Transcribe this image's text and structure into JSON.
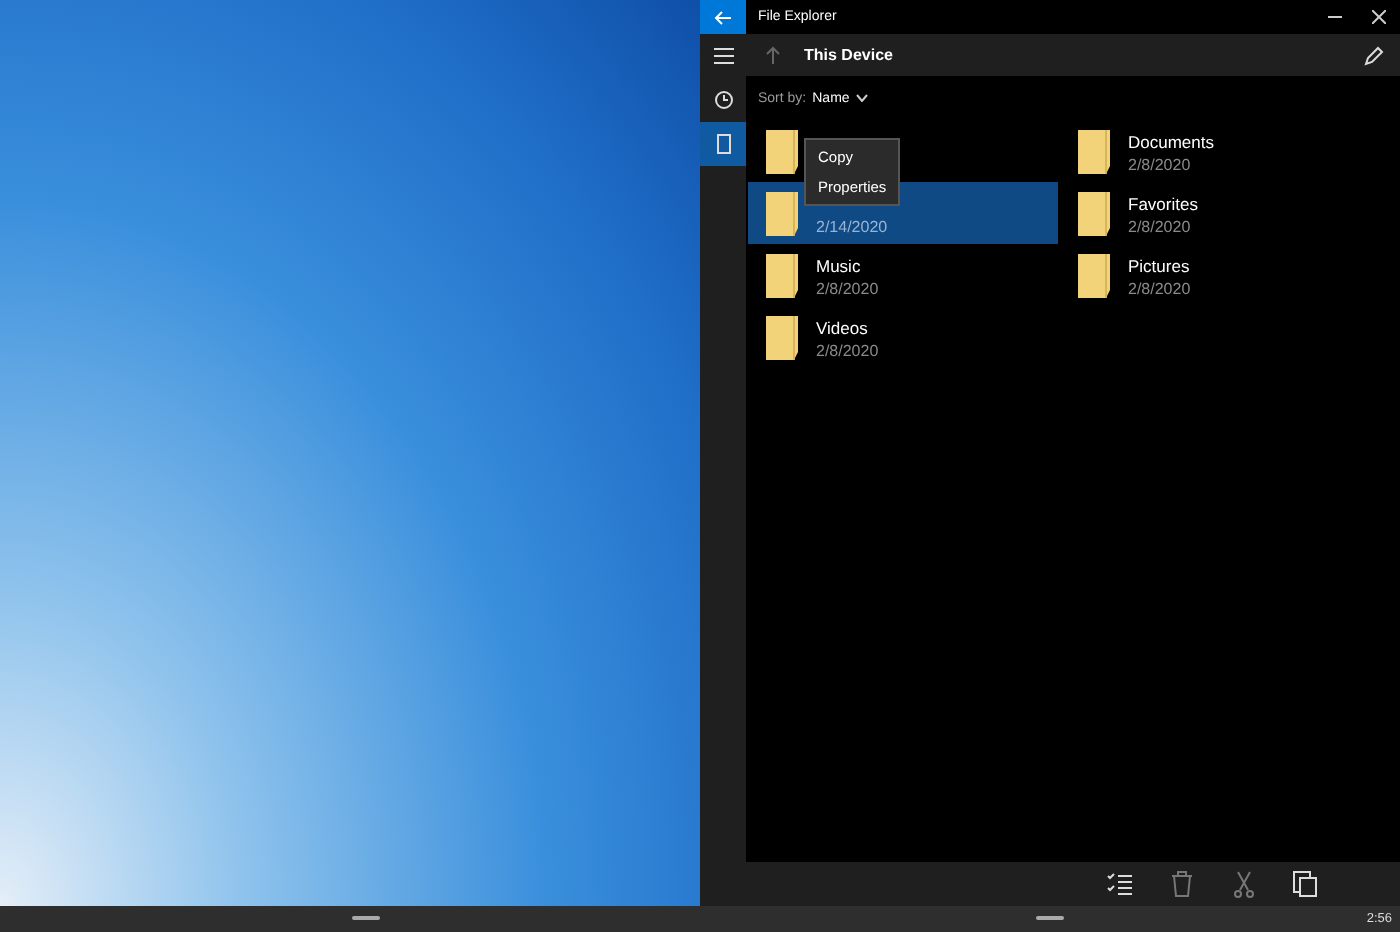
{
  "window": {
    "title": "File Explorer"
  },
  "header": {
    "title": "This Device"
  },
  "sort": {
    "label": "Sort by:",
    "value": "Name"
  },
  "nav_rail": [
    {
      "kind": "recent",
      "selected": false
    },
    {
      "kind": "device",
      "selected": true
    }
  ],
  "items": [
    {
      "selected": false
    },
    {
      "date": "2/14/2020",
      "selected": true
    },
    {
      "name": "Music",
      "date": "2/8/2020",
      "selected": false
    },
    {
      "name": "Videos",
      "date": "2/8/2020",
      "selected": false
    },
    {
      "name": "Documents",
      "date": "2/8/2020",
      "selected": false
    },
    {
      "name": "Favorites",
      "date": "2/8/2020",
      "selected": false
    },
    {
      "name": "Pictures",
      "date": "2/8/2020",
      "selected": false
    }
  ],
  "context_menu": [
    "Copy",
    "Properties"
  ],
  "taskbar": {
    "time": "2:56"
  }
}
